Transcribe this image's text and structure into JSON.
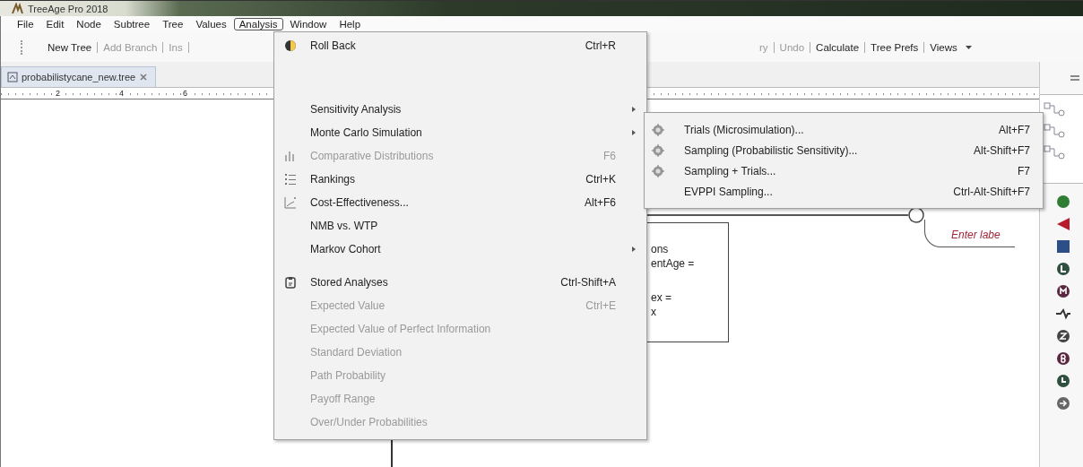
{
  "window": {
    "title": "TreeAge Pro 2018"
  },
  "menu_bar": [
    {
      "label": "File",
      "selected": false
    },
    {
      "label": "Edit",
      "selected": false
    },
    {
      "label": "Node",
      "selected": false
    },
    {
      "label": "Subtree",
      "selected": false
    },
    {
      "label": "Tree",
      "selected": false
    },
    {
      "label": "Values",
      "selected": false
    },
    {
      "label": "Analysis",
      "selected": true
    },
    {
      "label": "Window",
      "selected": false
    },
    {
      "label": "Help",
      "selected": false
    }
  ],
  "toolbar": {
    "left_items": [
      {
        "label": "New Tree",
        "disabled": false
      },
      {
        "label": "Add Branch",
        "disabled": true
      },
      {
        "label": "Ins",
        "disabled": true
      }
    ],
    "right_items": [
      {
        "label": "ry",
        "disabled": true
      },
      {
        "label": "Undo",
        "disabled": true
      },
      {
        "label": "Calculate",
        "disabled": false
      },
      {
        "label": "Tree Prefs",
        "disabled": false
      },
      {
        "label": "Views",
        "disabled": false,
        "dropdown": true
      }
    ]
  },
  "document_tab": {
    "label": "probabilistycane_new.tree",
    "selected": true
  },
  "ruler": {
    "labels": [
      "2",
      "4",
      "6"
    ]
  },
  "canvas": {
    "node_box": {
      "paragraphs": [
        [
          "ons",
          "entAge ="
        ],
        [
          "ex =",
          "x"
        ]
      ]
    },
    "branch_label": "Enter labe"
  },
  "analysis_menu": {
    "items": [
      {
        "kind": "item",
        "label": "Roll Back",
        "shortcut": "Ctrl+R",
        "disabled": false,
        "submenu": false
      },
      {
        "kind": "separator"
      },
      {
        "kind": "item",
        "label": "Sensitivity Analysis",
        "disabled": false,
        "submenu": true
      },
      {
        "kind": "item",
        "label": "Monte Carlo Simulation",
        "disabled": false,
        "submenu": true
      },
      {
        "kind": "item",
        "label": "Comparative Distributions",
        "shortcut": "F6",
        "disabled": true,
        "submenu": false
      },
      {
        "kind": "item",
        "label": "Rankings",
        "shortcut": "Ctrl+K",
        "disabled": false,
        "submenu": false
      },
      {
        "kind": "item",
        "label": "Cost-Effectiveness...",
        "shortcut": "Alt+F6",
        "disabled": false,
        "submenu": false
      },
      {
        "kind": "item",
        "label": "NMB vs. WTP",
        "disabled": false,
        "submenu": false
      },
      {
        "kind": "item",
        "label": "Markov Cohort",
        "disabled": false,
        "submenu": true
      },
      {
        "kind": "separator"
      },
      {
        "kind": "item",
        "label": "Stored Analyses",
        "shortcut": "Ctrl-Shift+A",
        "disabled": false,
        "submenu": false
      },
      {
        "kind": "item",
        "label": "Expected Value",
        "shortcut": "Ctrl+E",
        "disabled": true,
        "submenu": false
      },
      {
        "kind": "item",
        "label": "Expected Value of Perfect Information",
        "disabled": true,
        "submenu": false
      },
      {
        "kind": "item",
        "label": "Standard Deviation",
        "disabled": true,
        "submenu": false
      },
      {
        "kind": "item",
        "label": "Path Probability",
        "disabled": true,
        "submenu": false
      },
      {
        "kind": "item",
        "label": "Payoff Range",
        "disabled": true,
        "submenu": false
      },
      {
        "kind": "item",
        "label": "Over/Under Probabilities",
        "disabled": true,
        "submenu": false
      }
    ]
  },
  "monte_carlo_submenu": {
    "items": [
      {
        "label": "Trials (Microsimulation)...",
        "shortcut": "Alt+F7",
        "disabled": false
      },
      {
        "label": "Sampling (Probabilistic Sensitivity)...",
        "shortcut": "Alt-Shift+F7",
        "disabled": false
      },
      {
        "label": "Sampling + Trials...",
        "shortcut": "F7",
        "disabled": false
      },
      {
        "label": "EVPPI Sampling...",
        "shortcut": "Ctrl-Alt-Shift+F7",
        "disabled": false
      }
    ]
  }
}
